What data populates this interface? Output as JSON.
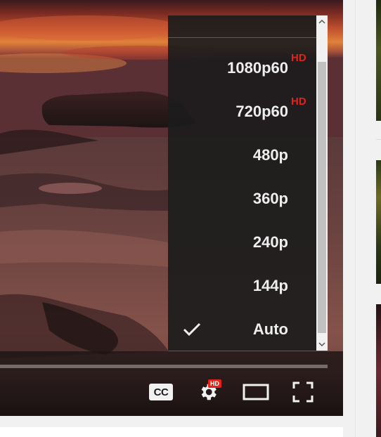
{
  "player": {
    "controls": {
      "cc_label": "CC",
      "settings_badge": "HD",
      "icons": [
        "cc-icon",
        "settings-gear-icon",
        "theater-mode-icon",
        "fullscreen-icon"
      ]
    },
    "quality_menu": {
      "items": [
        {
          "label": "1080p60",
          "badge": "HD",
          "selected": false
        },
        {
          "label": "720p60",
          "badge": "HD",
          "selected": false
        },
        {
          "label": "480p",
          "badge": "",
          "selected": false
        },
        {
          "label": "360p",
          "badge": "",
          "selected": false
        },
        {
          "label": "240p",
          "badge": "",
          "selected": false
        },
        {
          "label": "144p",
          "badge": "",
          "selected": false
        },
        {
          "label": "Auto",
          "badge": "",
          "selected": true
        }
      ]
    }
  },
  "colors": {
    "hd_red": "#e62117",
    "menu_background": "#1c1c1c",
    "menu_text": "#eeeeee"
  }
}
